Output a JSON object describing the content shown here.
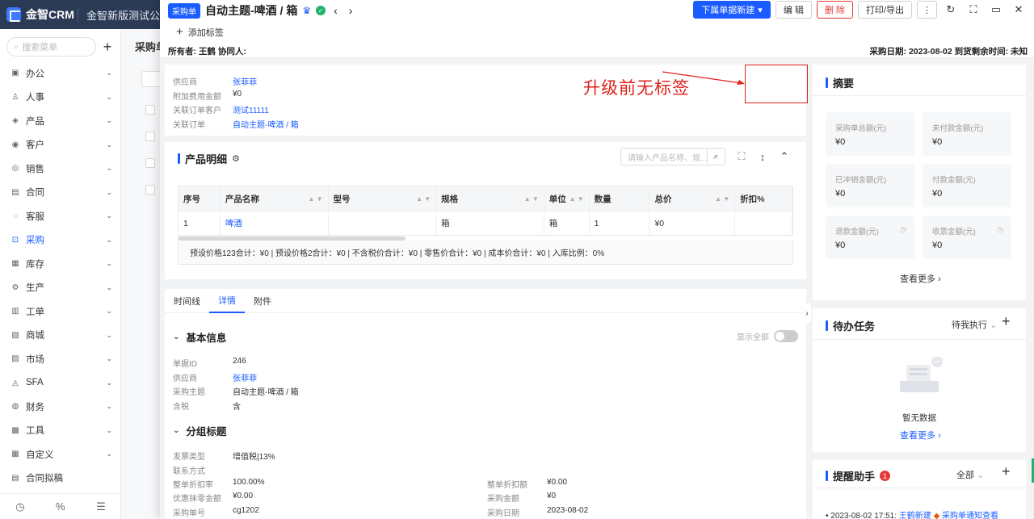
{
  "app": {
    "logo": "金智CRM",
    "company": "金智新版测试公司"
  },
  "sidebar": {
    "search_placeholder": "搜索菜单",
    "items": [
      {
        "label": "办公",
        "icon": "▣"
      },
      {
        "label": "人事",
        "icon": "♙"
      },
      {
        "label": "产品",
        "icon": "◈"
      },
      {
        "label": "客户",
        "icon": "◉"
      },
      {
        "label": "销售",
        "icon": "◎"
      },
      {
        "label": "合同",
        "icon": "▤"
      },
      {
        "label": "客服",
        "icon": "◌"
      },
      {
        "label": "采购",
        "icon": "⊡"
      },
      {
        "label": "库存",
        "icon": "▦"
      },
      {
        "label": "生产",
        "icon": "⚙"
      },
      {
        "label": "工单",
        "icon": "▥"
      },
      {
        "label": "商城",
        "icon": "▧"
      },
      {
        "label": "市场",
        "icon": "▨"
      },
      {
        "label": "SFA",
        "icon": "◬"
      },
      {
        "label": "财务",
        "icon": "◍"
      },
      {
        "label": "工具",
        "icon": "▩"
      },
      {
        "label": "自定义",
        "icon": "▦"
      },
      {
        "label": "合同拟稿",
        "icon": "▤"
      }
    ],
    "active_index": 7
  },
  "background": {
    "tab": "采购单"
  },
  "drawer": {
    "type_badge": "采购单",
    "title": "自动主题-啤酒 / 箱",
    "add_tag": "添加标签",
    "owner_line": "所有者: 王鹤  协同人:",
    "date_line": "采购日期: 2023-08-02  到货剩余时间: 未知",
    "actions": {
      "new_below": "下属单据新建",
      "edit": "编 辑",
      "delete": "删 除",
      "print": "打印/导出"
    }
  },
  "info": {
    "rows": [
      {
        "k": "供应商",
        "v": "张菲菲",
        "link": true
      },
      {
        "k": "附加费用金额",
        "v": "¥0",
        "link": false
      },
      {
        "k": "关联订单客户",
        "v": "测试11111",
        "link": true
      },
      {
        "k": "关联订单",
        "v": "自动主题-啤酒 / 箱",
        "link": true
      }
    ]
  },
  "annotation": {
    "text": "升级前无标签"
  },
  "product": {
    "title": "产品明细",
    "search_placeholder": "请输入产品名称、规...",
    "columns": [
      "序号",
      "产品名称",
      "型号",
      "规格",
      "单位",
      "数量",
      "总价",
      "折扣%"
    ],
    "rows": [
      [
        "1",
        "啤酒",
        "",
        "箱",
        "箱",
        "1",
        "¥0",
        ""
      ]
    ],
    "totals": "预设价格123合计：¥0 |   预设价格2合计：¥0 |   不含税价合计：¥0 |   零售价合计：¥0 |   成本价合计：¥0 |   入库比例：0%"
  },
  "tabs": [
    "时间线",
    "详情",
    "附件"
  ],
  "active_tab": 1,
  "detail": {
    "show_all": "显示全部",
    "basic_title": "基本信息",
    "basic": [
      {
        "k": "单据ID",
        "v": "246",
        "link": false
      },
      {
        "k": "供应商",
        "v": "张菲菲",
        "link": true
      },
      {
        "k": "采购主题",
        "v": "自动主题-啤酒 / 箱",
        "link": false
      },
      {
        "k": "含税",
        "v": "含",
        "link": false
      }
    ],
    "group_title": "分组标题",
    "group_left": [
      {
        "k": "发票类型",
        "v": "增值税|13%"
      },
      {
        "k": "联系方式",
        "v": ""
      },
      {
        "k": "整单折扣率",
        "v": "100.00%"
      },
      {
        "k": "优惠抹零金额",
        "v": "¥0.00"
      },
      {
        "k": "采购单号",
        "v": "cg1202"
      }
    ],
    "group_right": [
      {
        "k": "整单折扣额",
        "v": "¥0.00"
      },
      {
        "k": "采购金额",
        "v": "¥0"
      },
      {
        "k": "采购日期",
        "v": "2023-08-02"
      }
    ]
  },
  "summary": {
    "title": "摘要",
    "tiles": [
      {
        "label": "采购单总额(元)",
        "value": "¥0"
      },
      {
        "label": "未付款金额(元)",
        "value": "¥0"
      },
      {
        "label": "已冲销金额(元)",
        "value": "¥0"
      },
      {
        "label": "付款金额(元)",
        "value": "¥0"
      },
      {
        "label": "退款金额(元)",
        "value": "¥0"
      },
      {
        "label": "收票金额(元)",
        "value": "¥0"
      }
    ],
    "more": "查看更多"
  },
  "todo": {
    "title": "待办任务",
    "filter": "待我执行",
    "empty": "暂无数据",
    "more": "查看更多"
  },
  "reminder": {
    "title": "提醒助手",
    "count": "1",
    "filter": "全部",
    "item_time": "• 2023-08-02 17:51:",
    "item_link": "王鹤新建",
    "item_tail": "采购单通知查看"
  }
}
